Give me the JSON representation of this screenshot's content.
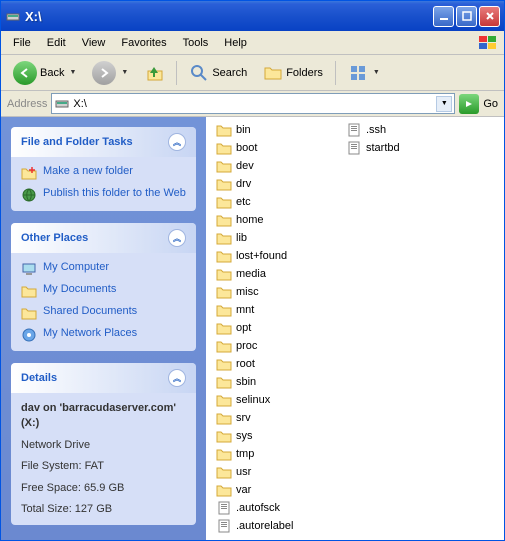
{
  "title": "X:\\",
  "menu": [
    "File",
    "Edit",
    "View",
    "Favorites",
    "Tools",
    "Help"
  ],
  "toolbar": {
    "back": "Back",
    "search": "Search",
    "folders": "Folders"
  },
  "address": {
    "label": "Address",
    "value": "X:\\",
    "go": "Go"
  },
  "sidebar": {
    "tasks": {
      "title": "File and Folder Tasks",
      "items": [
        {
          "label": "Make a new folder"
        },
        {
          "label": "Publish this folder to the Web"
        }
      ]
    },
    "places": {
      "title": "Other Places",
      "items": [
        {
          "label": "My Computer"
        },
        {
          "label": "My Documents"
        },
        {
          "label": "Shared Documents"
        },
        {
          "label": "My Network Places"
        }
      ]
    },
    "details": {
      "title": "Details",
      "name": "dav on 'barracudaserver.com' (X:)",
      "type": "Network Drive",
      "fs": "File System: FAT",
      "free": "Free Space: 65.9 GB",
      "total": "Total Size: 127 GB"
    }
  },
  "files": [
    {
      "name": "bin",
      "type": "folder"
    },
    {
      "name": "boot",
      "type": "folder"
    },
    {
      "name": "dev",
      "type": "folder"
    },
    {
      "name": "drv",
      "type": "folder"
    },
    {
      "name": "etc",
      "type": "folder"
    },
    {
      "name": "home",
      "type": "folder"
    },
    {
      "name": "lib",
      "type": "folder"
    },
    {
      "name": "lost+found",
      "type": "folder"
    },
    {
      "name": "media",
      "type": "folder"
    },
    {
      "name": "misc",
      "type": "folder"
    },
    {
      "name": "mnt",
      "type": "folder"
    },
    {
      "name": "opt",
      "type": "folder"
    },
    {
      "name": "proc",
      "type": "folder"
    },
    {
      "name": "root",
      "type": "folder"
    },
    {
      "name": "sbin",
      "type": "folder"
    },
    {
      "name": "selinux",
      "type": "folder"
    },
    {
      "name": "srv",
      "type": "folder"
    },
    {
      "name": "sys",
      "type": "folder"
    },
    {
      "name": "tmp",
      "type": "folder"
    },
    {
      "name": "usr",
      "type": "folder"
    },
    {
      "name": "var",
      "type": "folder"
    },
    {
      "name": ".autofsck",
      "type": "file"
    },
    {
      "name": ".autorelabel",
      "type": "file"
    },
    {
      "name": ".ssh",
      "type": "file"
    },
    {
      "name": "startbd",
      "type": "file"
    }
  ]
}
